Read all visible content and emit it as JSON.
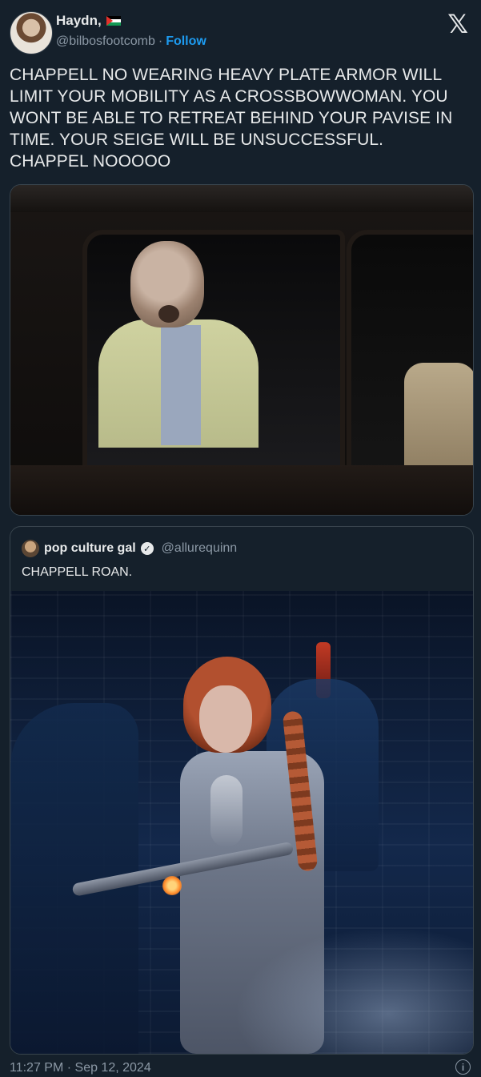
{
  "tweet": {
    "author_name": "Haydn,",
    "handle": "@bilbosfootcomb",
    "separator": "·",
    "follow_label": "Follow",
    "platform_logo": "𝕏",
    "text": "CHAPPELL NO WEARING HEAVY PLATE ARMOR WILL LIMIT YOUR MOBILITY AS A CROSSBOWWOMAN. YOU WONT BE ABLE TO RETREAT BEHIND YOUR PAVISE IN TIME. YOUR SEIGE WILL BE UNSUCCESSFUL. CHAPPEL NOOOOO",
    "timestamp": "11:27 PM · Sep 12, 2024",
    "info_icon_glyph": "i"
  },
  "quoted_tweet": {
    "author_name": "pop culture gal",
    "verified_glyph": "✓",
    "handle": "@allurequinn",
    "text": "CHAPPELL ROAN."
  },
  "icons": {
    "author_flag": "palestine-flag-icon",
    "close": "x-logo-icon",
    "verified": "verified-badge-icon",
    "info": "info-icon"
  },
  "colors": {
    "background": "#15202b",
    "text": "#e7e9ea",
    "muted": "#8b98a5",
    "link": "#1d9bf0",
    "border": "#38444d"
  }
}
